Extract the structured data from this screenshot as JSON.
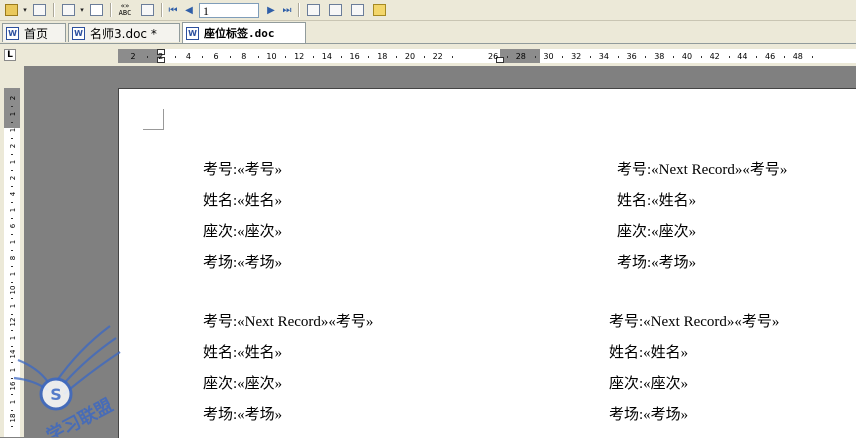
{
  "toolbar": {
    "record_number": "1"
  },
  "tabs": [
    {
      "label": "首页"
    },
    {
      "label": "名师3.doc *"
    },
    {
      "label": "座位标签.doc"
    }
  ],
  "ruler": {
    "corner_label": "L",
    "h_ticks": [
      "2",
      "2",
      "4",
      "6",
      "8",
      "10",
      "12",
      "14",
      "16",
      "18",
      "20",
      "22",
      "26",
      "28",
      "30",
      "32",
      "34",
      "36",
      "38",
      "40",
      "42",
      "44",
      "46",
      "48"
    ],
    "v_ticks": [
      "2",
      "1",
      "1",
      "2",
      "1",
      "2",
      "4",
      "1",
      "6",
      "1",
      "8",
      "1",
      "10",
      "1",
      "12",
      "1",
      "14",
      "1",
      "16",
      "1",
      "18"
    ]
  },
  "document": {
    "labels": [
      {
        "lines": [
          "考号:«考号»",
          "姓名:«姓名»",
          "座次:«座次»",
          "考场:«考场»"
        ]
      },
      {
        "lines": [
          "考号:«Next Record»«考号»",
          "姓名:«姓名»",
          "座次:«座次»",
          "考场:«考场»"
        ]
      },
      {
        "lines": [
          "考号:«Next Record»«考号»",
          "姓名:«姓名»",
          "座次:«座次»",
          "考场:«考场»"
        ]
      },
      {
        "lines": [
          "考号:«Next Record»«考号»",
          "姓名:«姓名»",
          "座次:«座次»",
          "考场:«考场»"
        ]
      }
    ]
  },
  "colors": {
    "chrome": "#ece9d8",
    "ruler_margin": "#8c8c8c",
    "workspace": "#808080",
    "watermark": "#3b68c4"
  },
  "watermark": {
    "text": "学习联盟"
  }
}
